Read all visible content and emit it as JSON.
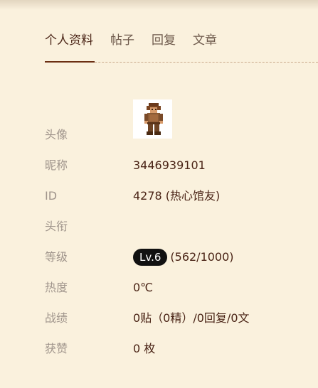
{
  "tabs": [
    {
      "label": "个人资料"
    },
    {
      "label": "帖子"
    },
    {
      "label": "回复"
    },
    {
      "label": "文章"
    }
  ],
  "profile": {
    "avatar_label": "头像",
    "nickname_label": "昵称",
    "nickname": "3446939101",
    "id_label": "ID",
    "id_value": "4278 (热心馆友)",
    "title_label": "头衔",
    "title_value": "",
    "level_label": "等级",
    "level_badge": "Lv.6",
    "level_progress": "(562/1000)",
    "heat_label": "热度",
    "heat_value": "0℃",
    "record_label": "战绩",
    "record_value": "0贴（0精）/0回复/0文",
    "likes_label": "获赞",
    "likes_value": "0 枚"
  },
  "colors": {
    "background": "#faf1dd",
    "accent": "#6b2e12",
    "label": "#a0958c",
    "value": "#4a2416",
    "badge_bg": "#111111"
  },
  "icons": {
    "avatar": "pixel-character-avatar"
  }
}
